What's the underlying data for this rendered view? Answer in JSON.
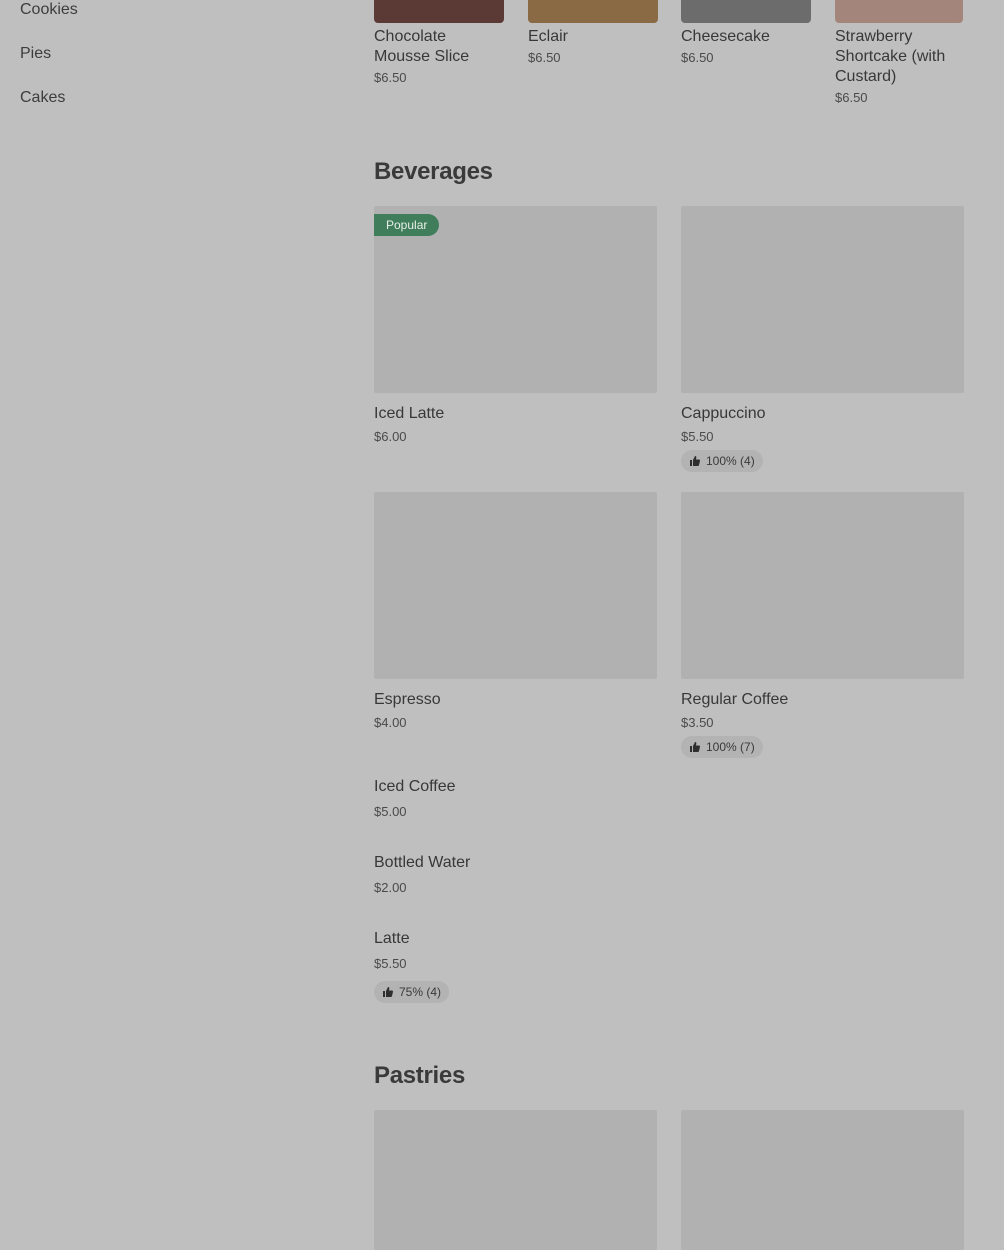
{
  "sidebar": {
    "items": [
      {
        "label": "Cookies"
      },
      {
        "label": "Pies"
      },
      {
        "label": "Cakes"
      }
    ]
  },
  "desserts": [
    {
      "name": "Chocolate Mousse Slice",
      "price": "$6.50",
      "color": "#5b3a35"
    },
    {
      "name": "Eclair",
      "price": "$6.50",
      "color": "#8a6a45"
    },
    {
      "name": "Cheesecake",
      "price": "$6.50",
      "color": "#6c6c6c"
    },
    {
      "name": "Strawberry Shortcake (with Custard)",
      "price": "$6.50",
      "color": "#a4857c"
    }
  ],
  "beverages": {
    "title": "Beverages",
    "cards": [
      {
        "name": "Iced Latte",
        "price": "$6.00",
        "badge": "Popular"
      },
      {
        "name": "Cappuccino",
        "price": "$5.50",
        "rating": "100% (4)"
      },
      {
        "name": "Espresso",
        "price": "$4.00"
      },
      {
        "name": "Regular Coffee",
        "price": "$3.50",
        "rating": "100% (7)"
      }
    ],
    "list": [
      {
        "name": "Iced Coffee",
        "price": "$5.00"
      },
      {
        "name": "Bottled Water",
        "price": "$2.00"
      },
      {
        "name": "Latte",
        "price": "$5.50",
        "rating": "75% (4)"
      }
    ]
  },
  "pastries": {
    "title": "Pastries"
  },
  "colors": {
    "badge_bg": "#3f7d5b",
    "placeholder": "#b1b1b1"
  }
}
